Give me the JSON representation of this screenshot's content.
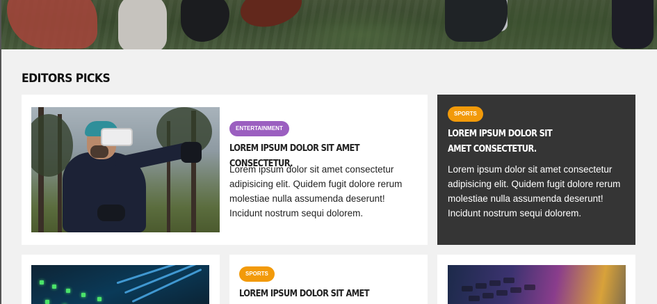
{
  "section": {
    "title": "EDITORS PICKS"
  },
  "cards": [
    {
      "badge": "ENTERTAINMENT",
      "badge_color": "#9b5fc0",
      "headline": "LOREM IPSUM DOLOR SIT AMET CONSECTETUR.",
      "body": "Lorem ipsum dolor sit amet consectetur adipisicing elit. Quidem fugit dolore rerum molestiae nulla assumenda deserunt! Incidunt nostrum sequi dolorem."
    },
    {
      "badge": "SPORTS",
      "badge_color": "#f29a0a",
      "headline": "LOREM IPSUM DOLOR SIT AMET CONSECTETUR.",
      "body": "Lorem ipsum dolor sit amet consectetur adipisicing elit. Quidem fugit dolore rerum molestiae nulla assumenda deserunt! Incidunt nostrum sequi dolorem."
    },
    {
      "badge": "SPORTS",
      "badge_color": "#f29a0a",
      "headline": "LOREM IPSUM DOLOR SIT AMET"
    }
  ],
  "colors": {
    "page_bg": "#f1f1f1",
    "dark_card": "#353535",
    "text_dark": "#111111"
  }
}
